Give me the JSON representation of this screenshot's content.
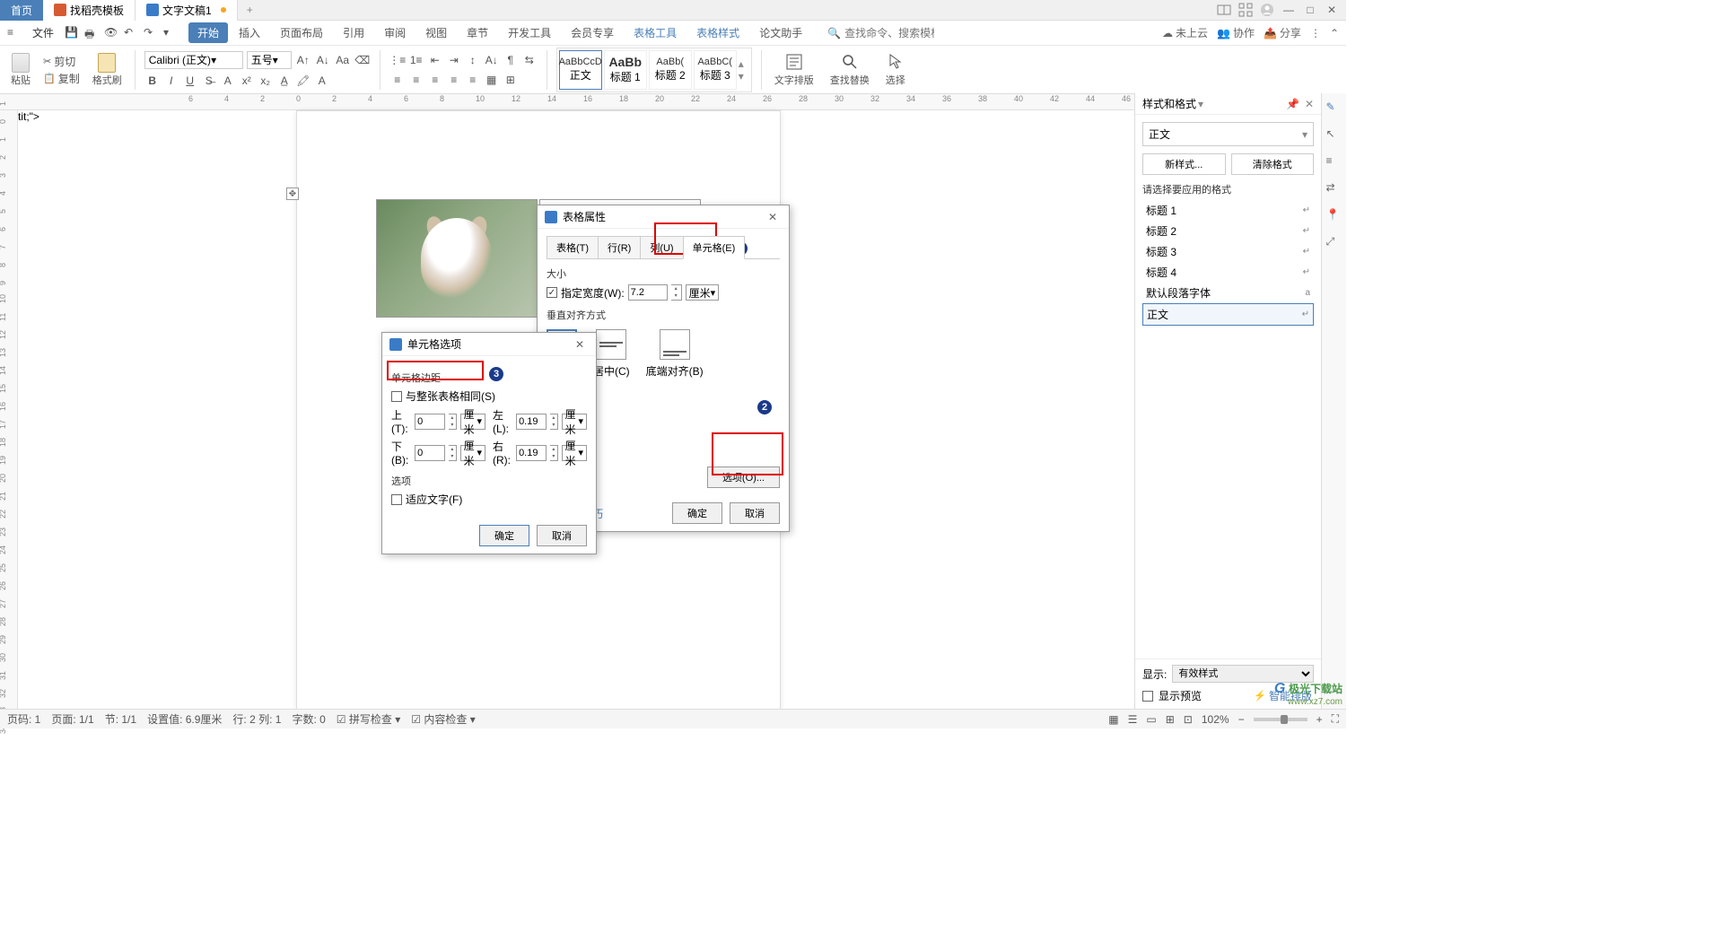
{
  "titleTabs": {
    "home": "首页",
    "templates": "找稻壳模板",
    "doc": "文字文稿1"
  },
  "menuBar": {
    "file": "文件",
    "items": [
      "开始",
      "插入",
      "页面布局",
      "引用",
      "审阅",
      "视图",
      "章节",
      "开发工具",
      "会员专享",
      "表格工具",
      "表格样式",
      "论文助手"
    ],
    "activeIndex": 0,
    "searchPlaceholder": "查找命令、搜索模板",
    "cloud": "未上云",
    "coop": "协作",
    "share": "分享"
  },
  "ribbon": {
    "paste": "粘贴",
    "cut": "剪切",
    "copy": "复制",
    "formatPainter": "格式刷",
    "fontName": "Calibri (正文)",
    "fontSize": "五号",
    "styles": [
      {
        "preview": "AaBbCcD",
        "name": "正文"
      },
      {
        "preview": "AaBb",
        "name": "标题 1"
      },
      {
        "preview": "AaBb(",
        "name": "标题 2"
      },
      {
        "preview": "AaBbC(",
        "name": "标题 3"
      }
    ],
    "textLayout": "文字排版",
    "findReplace": "查找替换",
    "select": "选择"
  },
  "dialog1": {
    "title": "表格属性",
    "tabs": [
      "表格(T)",
      "行(R)",
      "列(U)",
      "单元格(E)"
    ],
    "activeTab": 3,
    "size": "大小",
    "specWidth": "指定宽度(W):",
    "widthVal": "7.2",
    "unit": "厘米",
    "vAlign": "垂直对齐方式",
    "alignOpts": [
      "",
      "居中(C)",
      "底端对齐(B)"
    ],
    "optionsBtn": "选项(O)...",
    "helpLink": "操作技巧",
    "ok": "确定",
    "cancel": "取消"
  },
  "dialog2": {
    "title": "单元格选项",
    "margins": "单元格边距",
    "sameAsTable": "与整张表格相同(S)",
    "top": "上(T):",
    "bottom": "下(B):",
    "left": "左(L):",
    "right": "右(R):",
    "topVal": "0",
    "bottomVal": "0",
    "leftVal": "0.19",
    "rightVal": "0.19",
    "unit": "厘米",
    "options": "选项",
    "fitText": "适应文字(F)",
    "ok": "确定",
    "cancel": "取消"
  },
  "rightPanel": {
    "title": "样式和格式",
    "current": "正文",
    "newStyle": "新样式...",
    "clearFmt": "清除格式",
    "applyLabel": "请选择要应用的格式",
    "styles": [
      "标题 1",
      "标题 2",
      "标题 3",
      "标题 4",
      "默认段落字体",
      "正文"
    ],
    "selectedStyle": "正文",
    "showLabel": "显示:",
    "showValue": "有效样式",
    "preview": "显示预览",
    "smartLayout": "智能排版"
  },
  "status": {
    "page": "页码: 1",
    "pages": "页面: 1/1",
    "section": "节: 1/1",
    "setVal": "设置值: 6.9厘米",
    "rowcol": "行: 2  列: 1",
    "words": "字数: 0",
    "spell": "拼写检查",
    "content": "内容检查",
    "zoom": "102%"
  },
  "watermark": {
    "logo": "极光下载站",
    "url": "www.xz7.com"
  }
}
